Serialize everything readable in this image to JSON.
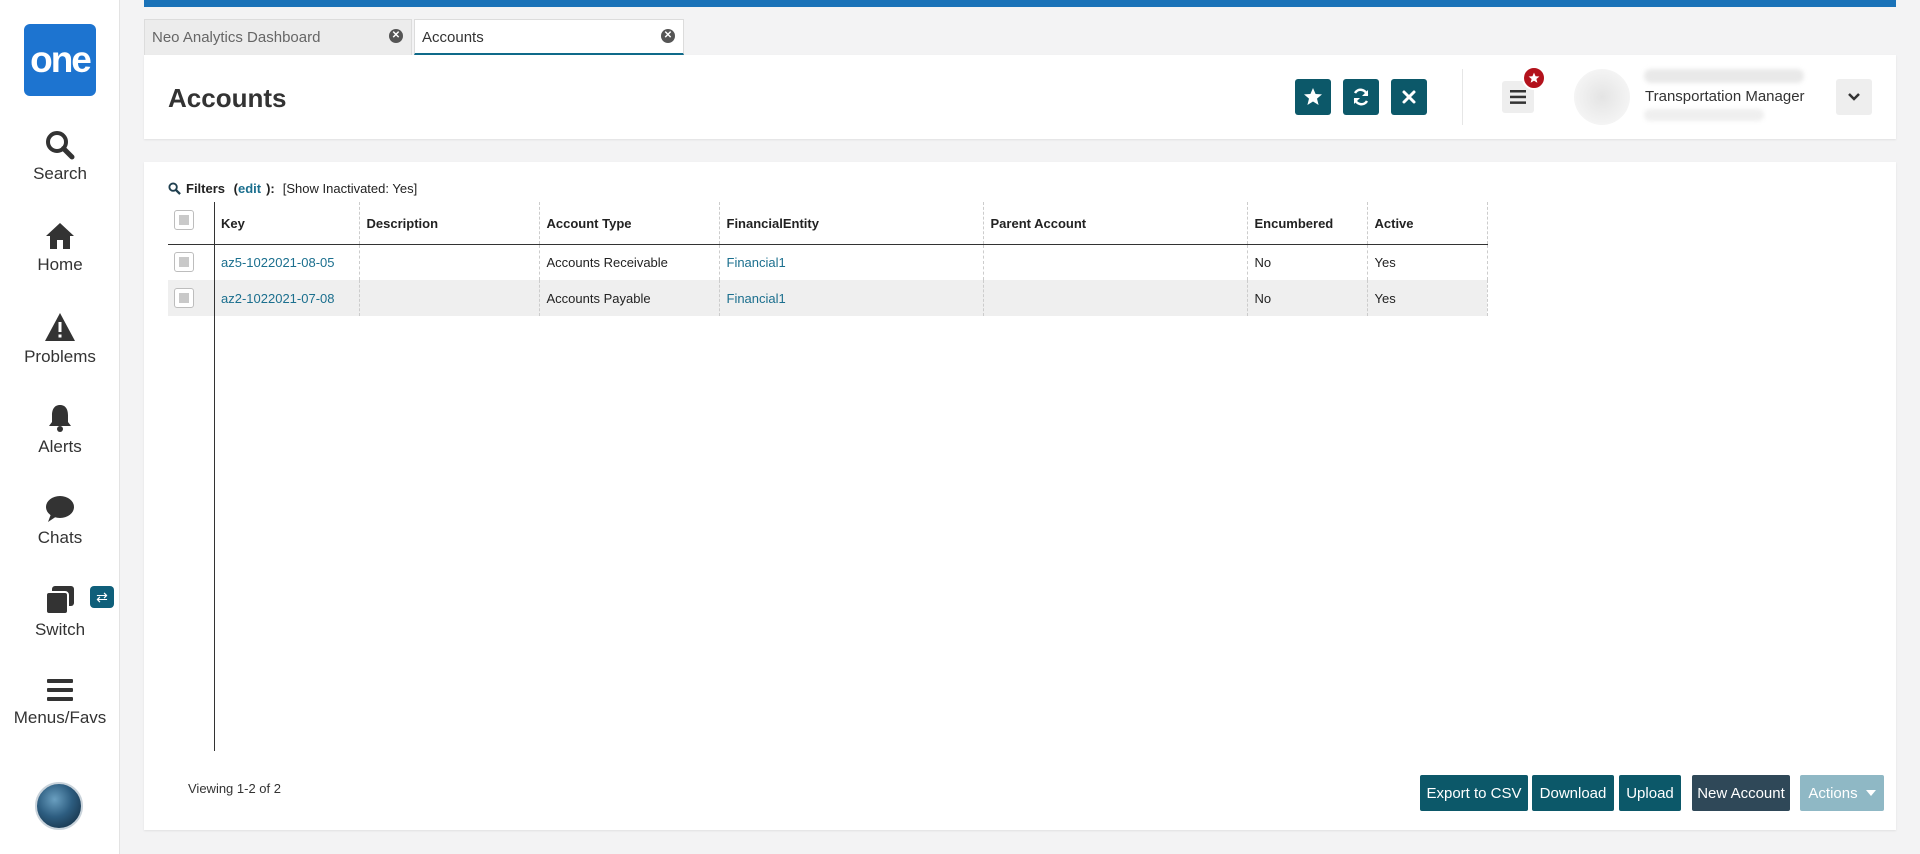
{
  "app": {
    "logo_text": "one",
    "brand_color": "#1d74d0",
    "accent_color": "#0c5869"
  },
  "nav": [
    {
      "label": "Search",
      "icon": "search-icon"
    },
    {
      "label": "Home",
      "icon": "home-icon"
    },
    {
      "label": "Problems",
      "icon": "warning-icon"
    },
    {
      "label": "Alerts",
      "icon": "bell-icon"
    },
    {
      "label": "Chats",
      "icon": "chat-icon"
    },
    {
      "label": "Switch",
      "icon": "switch-icon"
    },
    {
      "label": "Menus/Favs",
      "icon": "hamburger-icon"
    }
  ],
  "tabs": [
    {
      "label": "Neo Analytics Dashboard",
      "active": false
    },
    {
      "label": "Accounts",
      "active": true
    }
  ],
  "header": {
    "title": "Accounts",
    "user_role": "Transportation Manager"
  },
  "filters": {
    "label": "Filters",
    "edit_label": "edit",
    "value": "[Show Inactivated: Yes]"
  },
  "table": {
    "columns": [
      "Key",
      "Description",
      "Account Type",
      "FinancialEntity",
      "Parent Account",
      "Encumbered",
      "Active"
    ],
    "rows": [
      {
        "key": "az5-1022021-08-05",
        "description": "",
        "account_type": "Accounts Receivable",
        "financial_entity": "Financial1",
        "parent_account": "",
        "encumbered": "No",
        "active": "Yes"
      },
      {
        "key": "az2-1022021-07-08",
        "description": "",
        "account_type": "Accounts Payable",
        "financial_entity": "Financial1",
        "parent_account": "",
        "encumbered": "No",
        "active": "Yes"
      }
    ]
  },
  "footer": {
    "viewing": "Viewing 1-2 of 2",
    "buttons": {
      "export": "Export to CSV",
      "download": "Download",
      "upload": "Upload",
      "new_account": "New Account",
      "actions": "Actions"
    }
  }
}
